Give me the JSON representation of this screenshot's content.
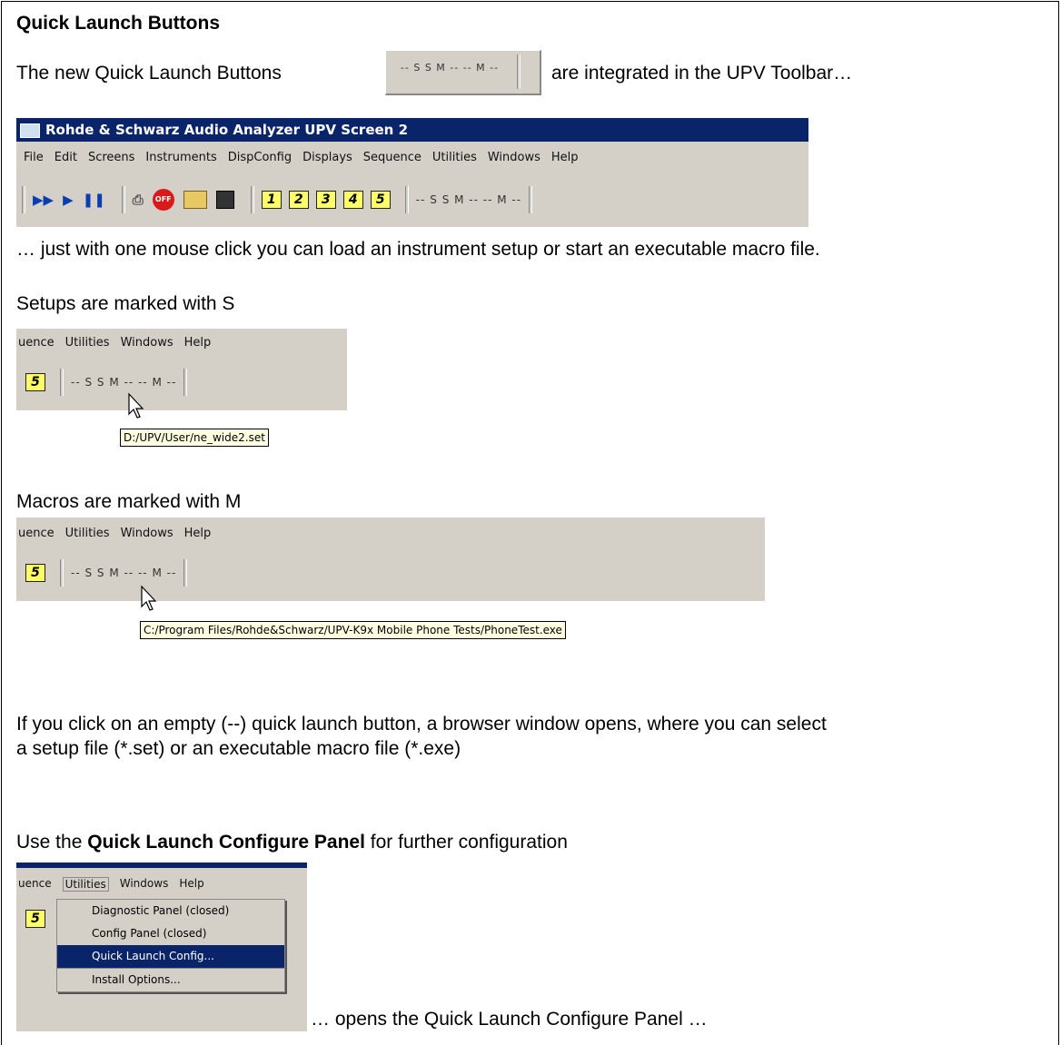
{
  "heading": "Quick Launch Buttons",
  "intro": {
    "before": "The new Quick Launch Buttons",
    "after": "are integrated in the UPV Toolbar…",
    "button_strip": "-- S S M -- -- M --"
  },
  "window": {
    "title": "Rohde & Schwarz Audio Analyzer UPV Screen 2",
    "menu": [
      "File",
      "Edit",
      "Screens",
      "Instruments",
      "DispConfig",
      "Displays",
      "Sequence",
      "Utilities",
      "Windows",
      "Help"
    ],
    "toolbar_numbers": [
      "1",
      "2",
      "3",
      "4",
      "5"
    ],
    "quick_launch": "-- S S M -- -- M --"
  },
  "line_one_click": "… just with one mouse click you can load an instrument setup or start an executable macro file.",
  "setups_label": "Setups are marked with S",
  "setups_shot": {
    "menu": [
      "uence",
      "Utilities",
      "Windows",
      "Help"
    ],
    "number": "5",
    "quick_launch": "-- S S M -- -- M --",
    "tooltip": "D:/UPV/User/ne_wide2.set"
  },
  "macros_label": "Macros are marked with M",
  "macros_shot": {
    "menu": [
      "uence",
      "Utilities",
      "Windows",
      "Help"
    ],
    "number": "5",
    "quick_launch": "-- S S M -- -- M --",
    "tooltip": "C:/Program Files/Rohde&Schwarz/UPV-K9x Mobile Phone Tests/PhoneTest.exe"
  },
  "empty_para": {
    "line1": "If you click on an empty (--) quick launch button, a browser window opens, where you can select",
    "line2": "a setup file (*.set) or an executable macro file (*.exe)"
  },
  "configure": {
    "before": "Use the ",
    "bold": "Quick Launch Configure Panel",
    "after": " for further configuration"
  },
  "menu_shot": {
    "menu": [
      "uence",
      "Utilities",
      "Windows",
      "Help"
    ],
    "number": "5",
    "items": [
      "Diagnostic Panel (closed)",
      "Config Panel (closed)",
      "Quick Launch Config...",
      "Install Options..."
    ]
  },
  "opens_text": "… opens the Quick Launch Configure Panel …"
}
